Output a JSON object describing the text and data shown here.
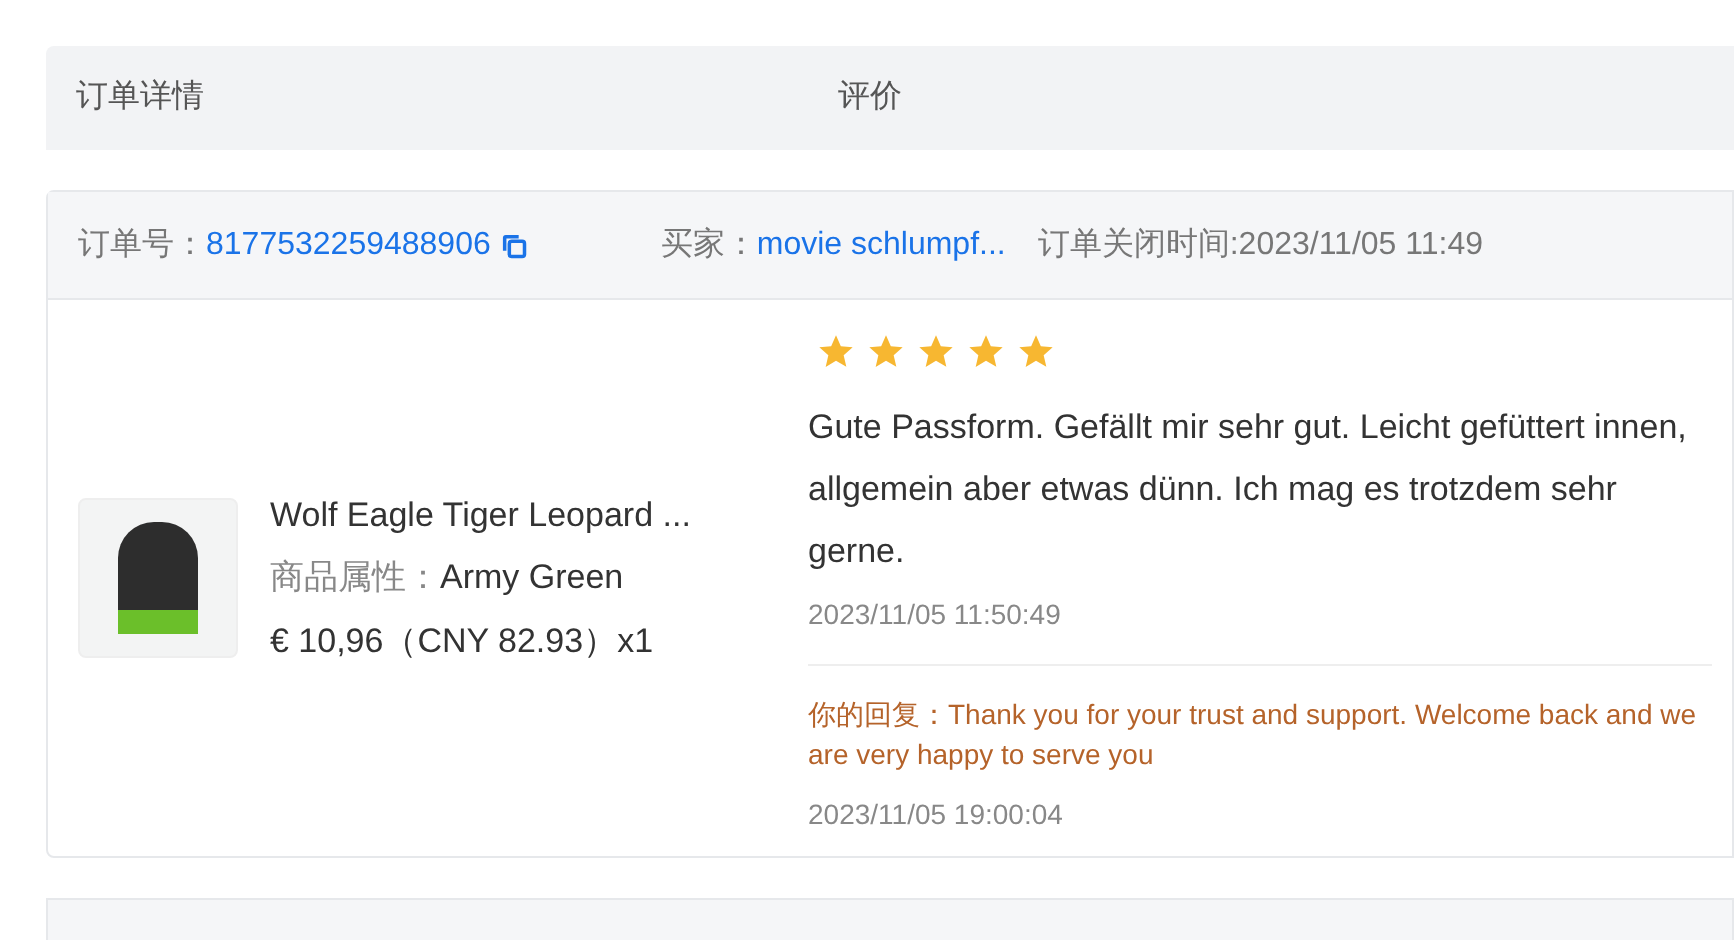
{
  "table_header": {
    "columns": [
      "订单详情",
      "评价"
    ]
  },
  "orders": [
    {
      "order_no_label": "订单号：",
      "order_no": "8177532259488906",
      "buyer_label": "买家：",
      "buyer": "movie schlumpf...",
      "closed_time": "订单关闭时间:2023/11/05 11:49",
      "product": {
        "title": "Wolf Eagle Tiger Leopard ...",
        "attr_label": "商品属性：",
        "attr_value": "Army Green",
        "price": "€ 10,96（CNY  82.93）x1"
      },
      "review": {
        "stars": 5,
        "text": "Gute Passform. Gefällt mir sehr gut. Leicht gefüttert innen, allgemein aber etwas dünn. Ich mag es trotzdem sehr gerne.",
        "time": "2023/11/05 11:50:49",
        "reply_label": "你的回复：",
        "reply": "Thank you for your trust and support. Welcome back and we are very happy to serve you",
        "reply_time": "2023/11/05 19:00:04"
      }
    }
  ]
}
